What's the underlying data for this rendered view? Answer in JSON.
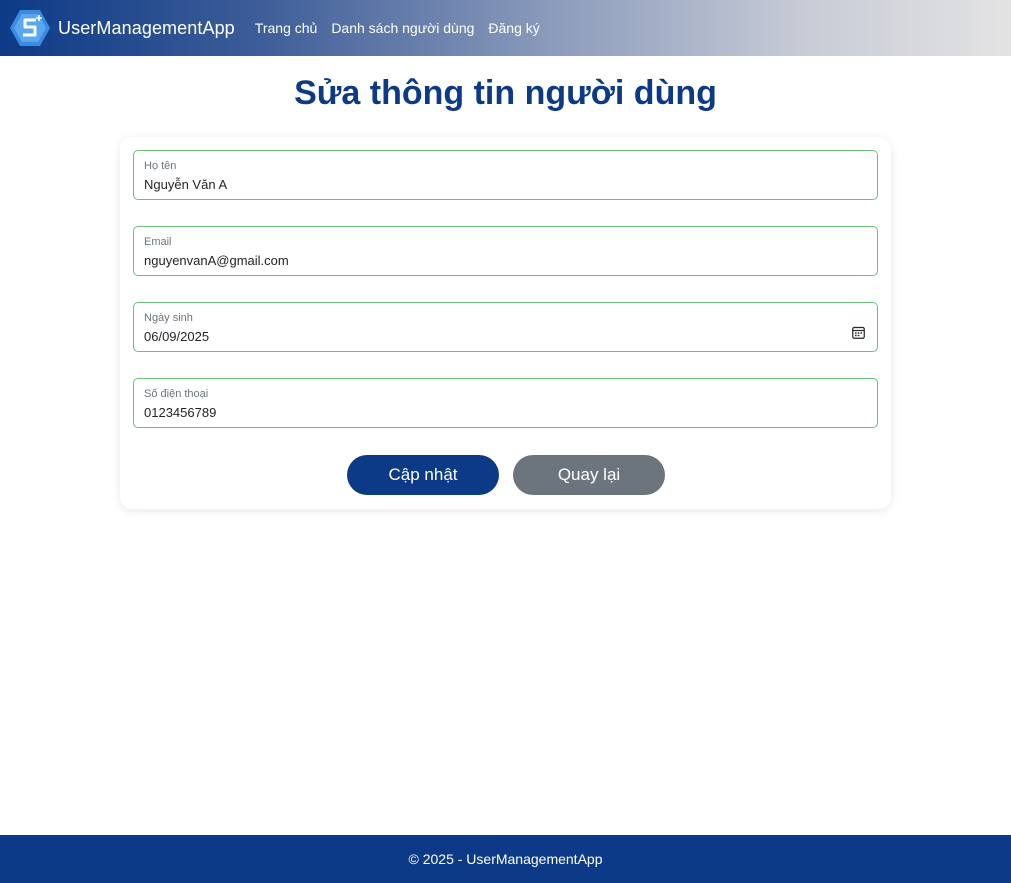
{
  "navbar": {
    "brand": "UserManagementApp",
    "logo_icon": "hexagon-s-logo",
    "links": [
      {
        "label": "Trang chủ"
      },
      {
        "label": "Danh sách người dùng"
      },
      {
        "label": "Đăng ký"
      }
    ]
  },
  "page": {
    "title": "Sửa thông tin người dùng"
  },
  "form": {
    "fields": [
      {
        "label": "Họ tên",
        "value": "Nguyễn Văn A"
      },
      {
        "label": "Email",
        "value": "nguyenvanA@gmail.com"
      },
      {
        "label": "Ngày sinh",
        "value": "06/09/2025",
        "icon": "calendar-icon"
      },
      {
        "label": "Số điện thoại",
        "value": "0123456789"
      }
    ],
    "submit_label": "Cập nhật",
    "back_label": "Quay lại"
  },
  "footer": {
    "text": "© 2025 - UserManagementApp"
  },
  "colors": {
    "primary": "#0d3a86",
    "secondary": "#6c757d",
    "field_border": "#6cc07a"
  }
}
